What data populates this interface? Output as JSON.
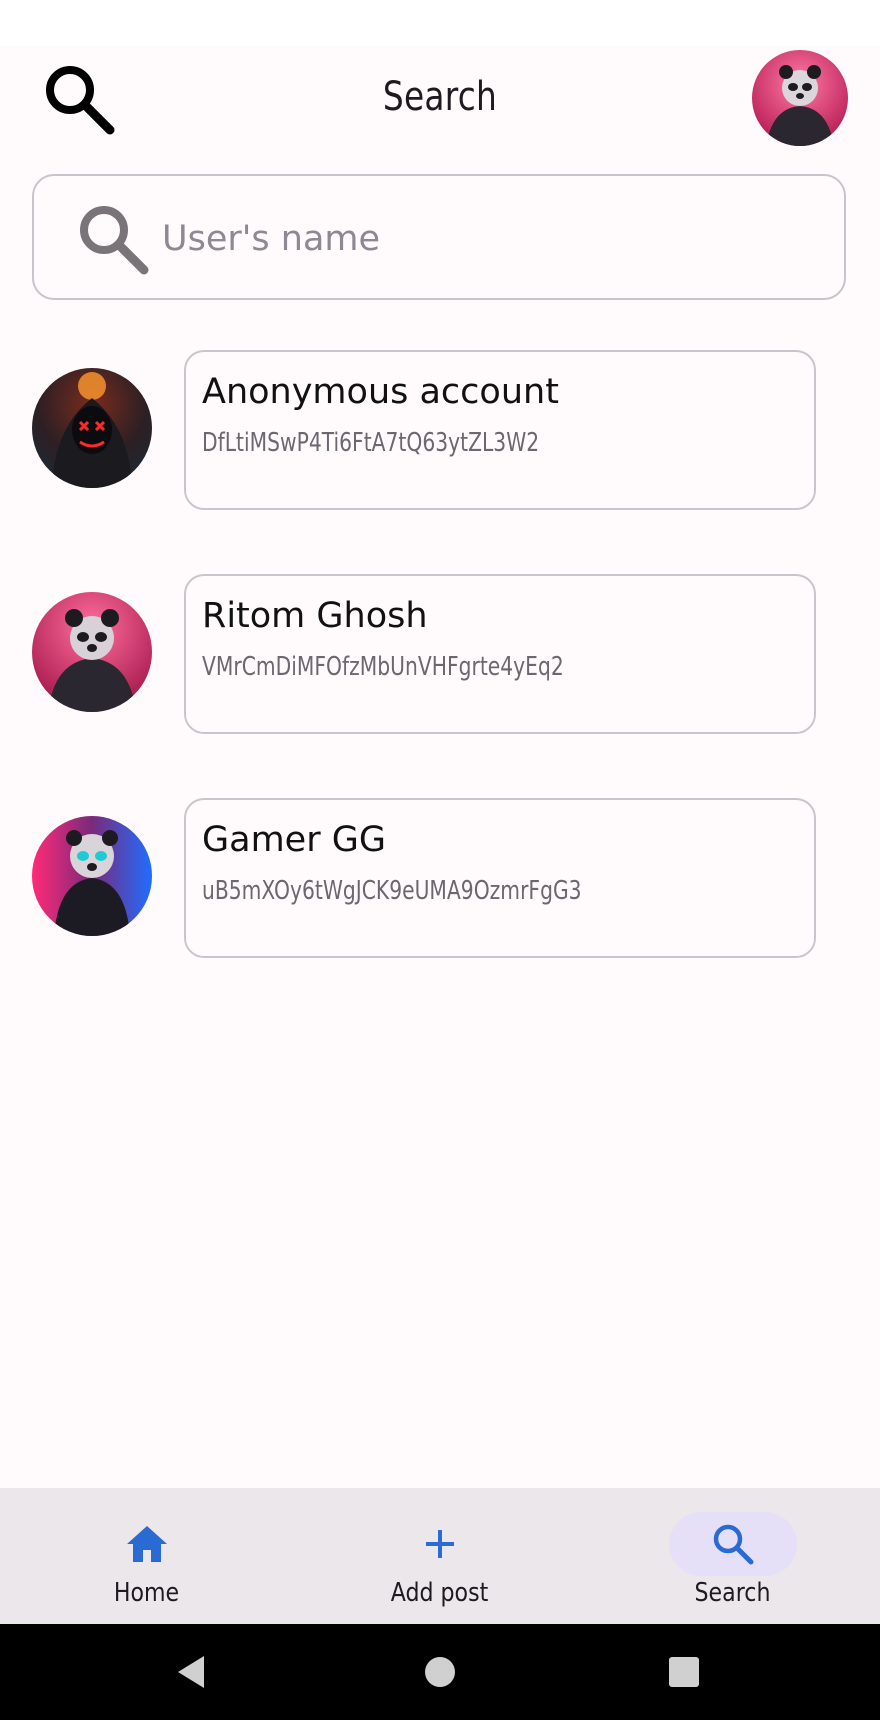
{
  "header": {
    "title": "Search",
    "search_icon": "search-icon",
    "profile_avatar": "panda-avatar"
  },
  "search": {
    "placeholder": "User's name",
    "value": "",
    "icon": "search-icon"
  },
  "users": [
    {
      "name": "Anonymous account",
      "id": "DfLtiMSwP4Ti6FtA7tQ63ytZL3W2",
      "avatar": "masked-hooded-figure-avatar"
    },
    {
      "name": "Ritom Ghosh",
      "id": "VMrCmDiMFOfzMbUnVHFgrte4yEq2",
      "avatar": "panda-hoodie-avatar"
    },
    {
      "name": "Gamer GG",
      "id": "uB5mXOy6tWgJCK9eUMA9OzmrFgG3",
      "avatar": "panda-gamer-avatar"
    }
  ],
  "bottom_nav": {
    "items": [
      {
        "label": "Home",
        "icon": "home-icon",
        "active": false
      },
      {
        "label": "Add post",
        "icon": "plus-icon",
        "active": false
      },
      {
        "label": "Search",
        "icon": "search-icon",
        "active": true
      }
    ]
  },
  "system_nav": {
    "back": "back-icon",
    "home": "home-circle-icon",
    "recents": "recents-icon"
  },
  "colors": {
    "background": "#fffbfd",
    "accent": "#2a6ad3",
    "active_pill": "#e6dff8",
    "nav_bar": "#ece7ea",
    "border": "#c8c4cb"
  }
}
